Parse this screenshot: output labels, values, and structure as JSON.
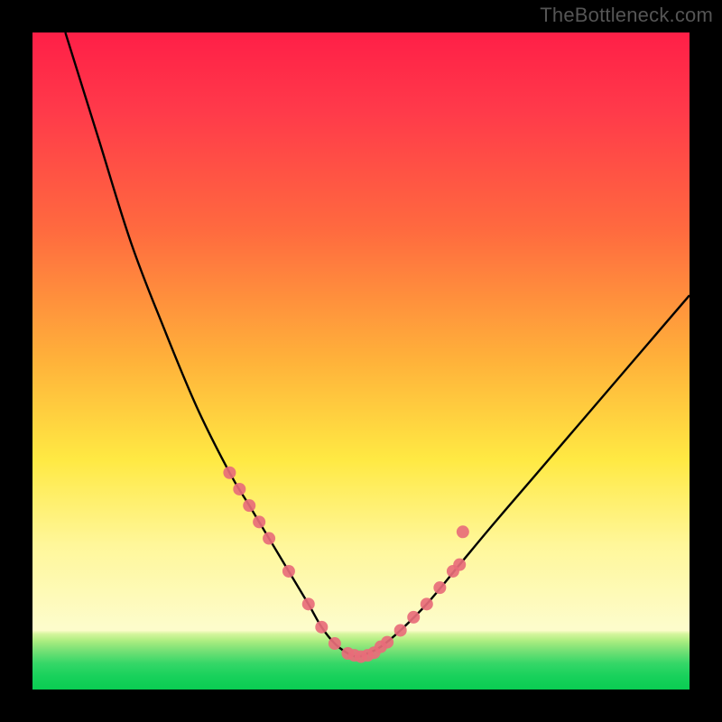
{
  "watermark": "TheBottleneck.com",
  "colors": {
    "background_frame": "#000000",
    "curve_stroke": "#000000",
    "marker_fill": "#e86d79",
    "marker_stroke": "#c44a58",
    "gradient_top": "#ff1f47",
    "gradient_bottom": "#0acd52"
  },
  "chart_data": {
    "type": "line",
    "title": "",
    "xlabel": "",
    "ylabel": "",
    "xlim": [
      0,
      100
    ],
    "ylim": [
      0,
      100
    ],
    "series": [
      {
        "name": "bottleneck-curve",
        "x": [
          5,
          10,
          15,
          20,
          25,
          30,
          33,
          36,
          39,
          42,
          44,
          46,
          48,
          49.5,
          51,
          53,
          56,
          60,
          65,
          70,
          76,
          82,
          88,
          94,
          100
        ],
        "y": [
          100,
          84,
          68,
          55,
          43,
          33,
          28,
          23,
          18,
          13,
          9.5,
          7,
          5.5,
          5,
          5.5,
          6.5,
          9,
          13,
          19,
          25,
          32,
          39,
          46,
          53,
          60
        ]
      }
    ],
    "markers": {
      "name": "highlighted-points",
      "x": [
        30,
        31.5,
        33,
        34.5,
        36,
        39,
        42,
        44,
        46,
        48,
        49,
        50,
        51,
        52,
        53,
        54,
        56,
        58,
        60,
        62,
        64,
        65,
        65.5
      ],
      "y": [
        33,
        30.5,
        28,
        25.5,
        23,
        18,
        13,
        9.5,
        7,
        5.5,
        5.2,
        5,
        5.2,
        5.6,
        6.5,
        7.2,
        9,
        11,
        13,
        15.5,
        18,
        19,
        24
      ]
    }
  }
}
